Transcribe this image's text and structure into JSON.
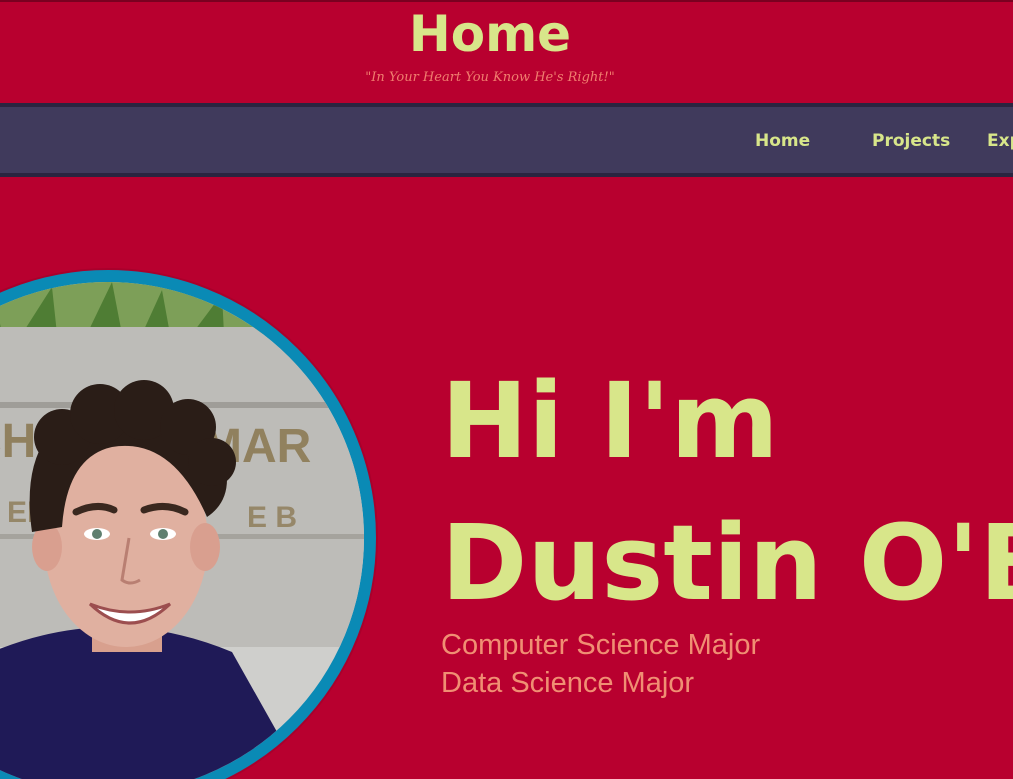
{
  "header": {
    "title": "Home",
    "tagline": "\"In Your Heart You Know He's Right!\""
  },
  "nav": {
    "items": [
      {
        "label": "Home"
      },
      {
        "label": "Projects"
      },
      {
        "label": "Experience"
      }
    ]
  },
  "hero": {
    "greeting": "Hi I'm",
    "name": "Dustin O'Brien",
    "roles": [
      "Computer Science Major",
      "Data Science Major"
    ]
  },
  "colors": {
    "background": "#b8002f",
    "nav_background": "#403a5c",
    "accent_text": "#d8e68a",
    "secondary_text": "#f08f73",
    "portrait_ring": "#0a8ab5"
  },
  "icons": {
    "portrait": "profile-photo"
  }
}
